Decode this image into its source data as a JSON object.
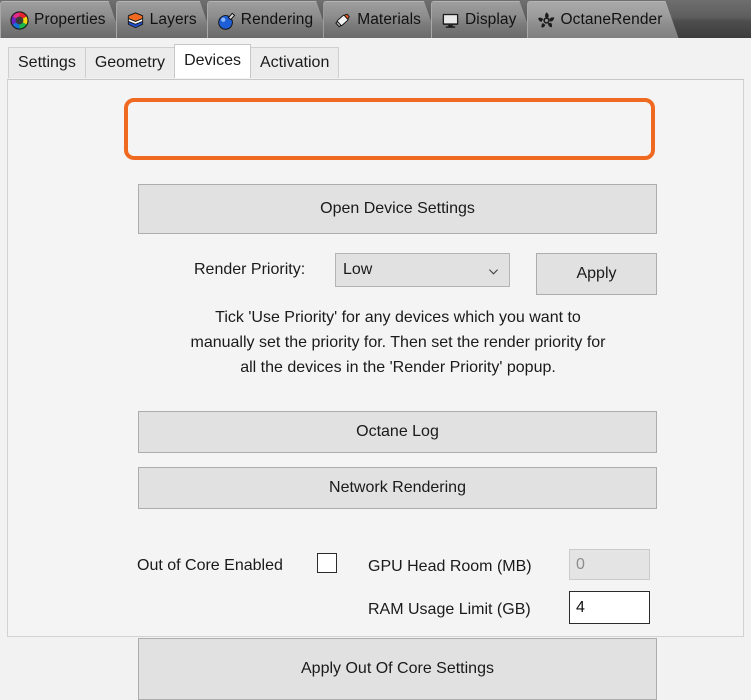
{
  "top_tabs": [
    {
      "label": "Properties",
      "icon": "color-wheel-icon",
      "active": false
    },
    {
      "label": "Layers",
      "icon": "layers-stack-icon",
      "active": false
    },
    {
      "label": "Rendering",
      "icon": "render-sphere-icon",
      "active": false
    },
    {
      "label": "Materials",
      "icon": "paint-tube-icon",
      "active": false
    },
    {
      "label": "Display",
      "icon": "monitor-icon",
      "active": false
    },
    {
      "label": "OctaneRender",
      "icon": "octane-fan-icon",
      "active": true
    }
  ],
  "sub_tabs": [
    {
      "label": "Settings",
      "active": false
    },
    {
      "label": "Geometry",
      "active": false
    },
    {
      "label": "Devices",
      "active": true
    },
    {
      "label": "Activation",
      "active": false
    }
  ],
  "content": {
    "open_device_settings_label": "Open Device Settings",
    "render_priority_label": "Render Priority:",
    "render_priority_value": "Low",
    "apply_label": "Apply",
    "help_line_1": "Tick 'Use Priority' for any devices which you want to",
    "help_line_2": "manually set the priority for.  Then set the render priority for",
    "help_line_3": "all the devices in the 'Render Priority' popup.",
    "octane_log_label": "Octane Log",
    "network_rendering_label": "Network Rendering",
    "out_of_core_label": "Out of Core Enabled",
    "out_of_core_checked": false,
    "gpu_head_room_label": "GPU Head Room (MB)",
    "gpu_head_room_value": "0",
    "gpu_head_room_enabled": false,
    "ram_usage_label": "RAM Usage Limit (GB)",
    "ram_usage_value": "4",
    "ram_usage_enabled": true,
    "apply_out_of_core_label": "Apply Out Of Core Settings"
  },
  "colors": {
    "highlight_orange": "#ef6a20",
    "panel_bg": "#f4f4f4",
    "button_bg": "#e1e1e1",
    "topbar_dark": "#4e4e4e"
  }
}
